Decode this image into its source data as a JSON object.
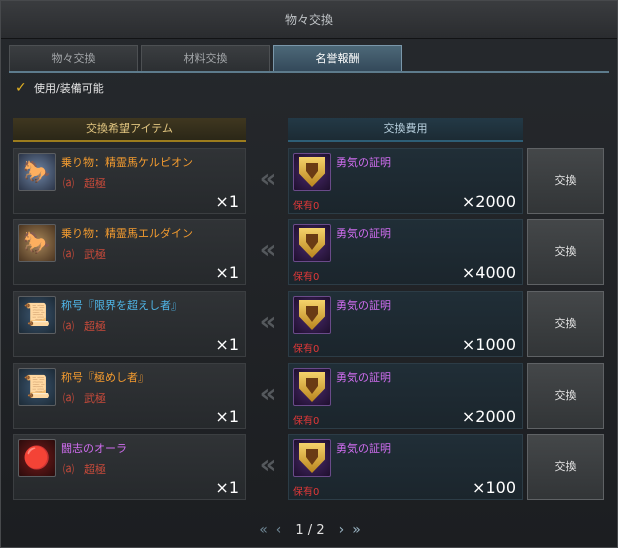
{
  "window": {
    "title": "物々交換"
  },
  "tabs": [
    {
      "label": "物々交換",
      "active": false
    },
    {
      "label": "材料交換",
      "active": false
    },
    {
      "label": "名誉報酬",
      "active": true
    }
  ],
  "filter": {
    "label": "使用/装備可能",
    "checked": true
  },
  "headers": {
    "left": "交換希望アイテム",
    "right": "交換費用"
  },
  "rows": [
    {
      "item_name": "乗り物：精霊馬ケルピオン",
      "item_color": "#f39b2f",
      "grade_symbol": "⒜",
      "grade": "超極",
      "count": "×1",
      "cost_name": "勇気の証明",
      "own": "保有0",
      "amount": "×2000",
      "button": "交換",
      "icon": "horse-kelpion-icon"
    },
    {
      "item_name": "乗り物：精霊馬エルダイン",
      "item_color": "#f39b2f",
      "grade_symbol": "⒜",
      "grade": "武極",
      "count": "×1",
      "cost_name": "勇気の証明",
      "own": "保有0",
      "amount": "×4000",
      "button": "交換",
      "icon": "horse-eldain-icon"
    },
    {
      "item_name": "称号『限界を超えし者』",
      "item_color": "#4fb6e8",
      "grade_symbol": "⒜",
      "grade": "超極",
      "count": "×1",
      "cost_name": "勇気の証明",
      "own": "保有0",
      "amount": "×1000",
      "button": "交換",
      "icon": "title-scroll-icon"
    },
    {
      "item_name": "称号『極めし者』",
      "item_color": "#f39b2f",
      "grade_symbol": "⒜",
      "grade": "武極",
      "count": "×1",
      "cost_name": "勇気の証明",
      "own": "保有0",
      "amount": "×2000",
      "button": "交換",
      "icon": "title-scroll-icon"
    },
    {
      "item_name": "闘志のオーラ",
      "item_color": "#d06df0",
      "grade_symbol": "⒜",
      "grade": "超極",
      "count": "×1",
      "cost_name": "勇気の証明",
      "own": "保有0",
      "amount": "×100",
      "button": "交換",
      "icon": "aura-orb-icon"
    }
  ],
  "pager": {
    "first": "«",
    "prev": "‹",
    "page": "1 / 2",
    "next": "›",
    "last": "»"
  },
  "arrow_glyph": "«"
}
